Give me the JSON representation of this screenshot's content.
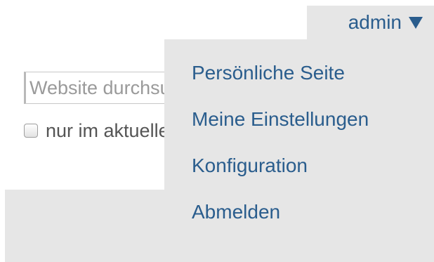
{
  "search": {
    "placeholder": "Website durchsuchen"
  },
  "scope_checkbox": {
    "label": "nur im aktuellen Projekt",
    "checked": false
  },
  "user_menu": {
    "username": "admin",
    "icon": "caret-down-icon",
    "items": [
      {
        "label": "Persönliche Seite"
      },
      {
        "label": "Meine Einstellungen"
      },
      {
        "label": "Konfiguration"
      },
      {
        "label": "Abmelden"
      }
    ]
  },
  "colors": {
    "link": "#2a5d8d",
    "menu_background": "#e6e6e6",
    "page_background": "#ffffff"
  }
}
